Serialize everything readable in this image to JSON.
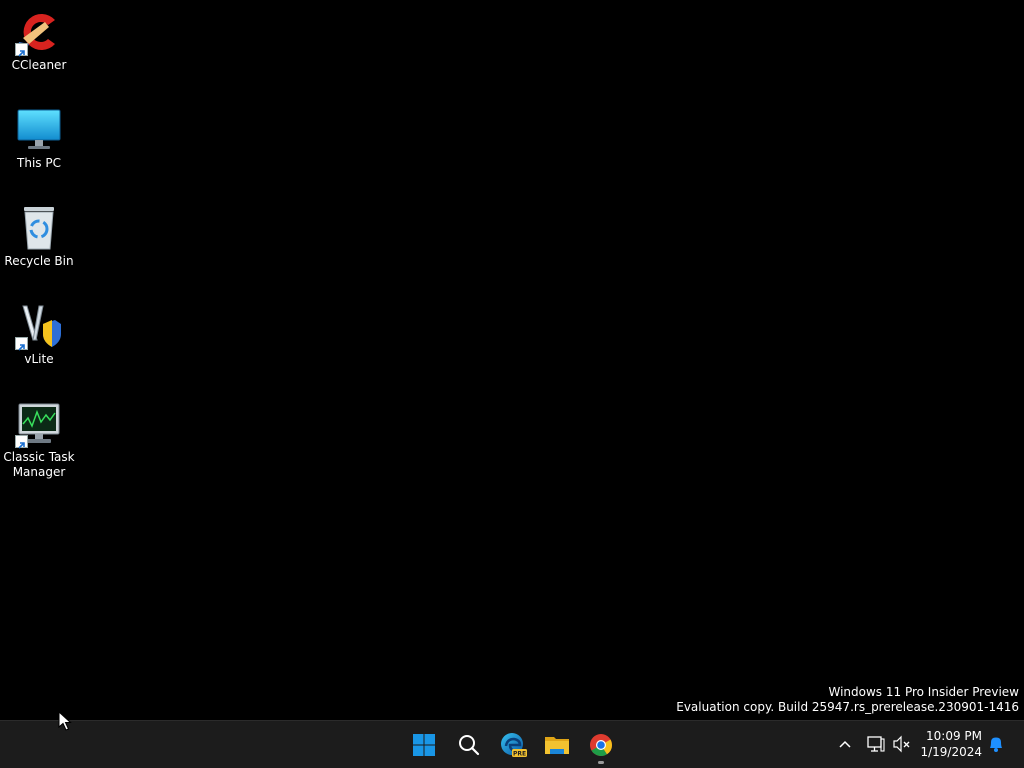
{
  "desktop": {
    "icons": [
      {
        "label": "CCleaner",
        "icon": "ccleaner-icon",
        "shortcut": true
      },
      {
        "label": "This PC",
        "icon": "computer-monitor-icon",
        "shortcut": false
      },
      {
        "label": "Recycle Bin",
        "icon": "recycle-bin-icon",
        "shortcut": false
      },
      {
        "label": "vLite",
        "icon": "vlite-icon",
        "shortcut": true
      },
      {
        "label": "Classic Task\nManager",
        "icon": "task-manager-icon",
        "shortcut": true
      }
    ]
  },
  "watermark": {
    "line1": "Windows 11 Pro Insider Preview",
    "line2": "Evaluation copy. Build 25947.rs_prerelease.230901-1416"
  },
  "taskbar": {
    "pinned": [
      {
        "name": "start-button",
        "icon": "windows-logo-icon"
      },
      {
        "name": "search-button",
        "icon": "search-icon"
      },
      {
        "name": "edge-pre-button",
        "icon": "edge-pre-icon",
        "badge": "PRE"
      },
      {
        "name": "file-explorer-button",
        "icon": "folder-icon"
      },
      {
        "name": "chrome-button",
        "icon": "chrome-icon",
        "running": true
      }
    ],
    "tray": {
      "icons": [
        "chevron-up-icon",
        "network-icon",
        "volume-muted-icon"
      ],
      "time": "10:09 PM",
      "date": "1/19/2024",
      "notification_icon": "bell-icon"
    }
  },
  "colors": {
    "desktop_bg": "#000000",
    "taskbar_bg": "#1c1c1c",
    "windows_blue": "#0a7fd8",
    "folder_yellow": "#f2c230"
  }
}
